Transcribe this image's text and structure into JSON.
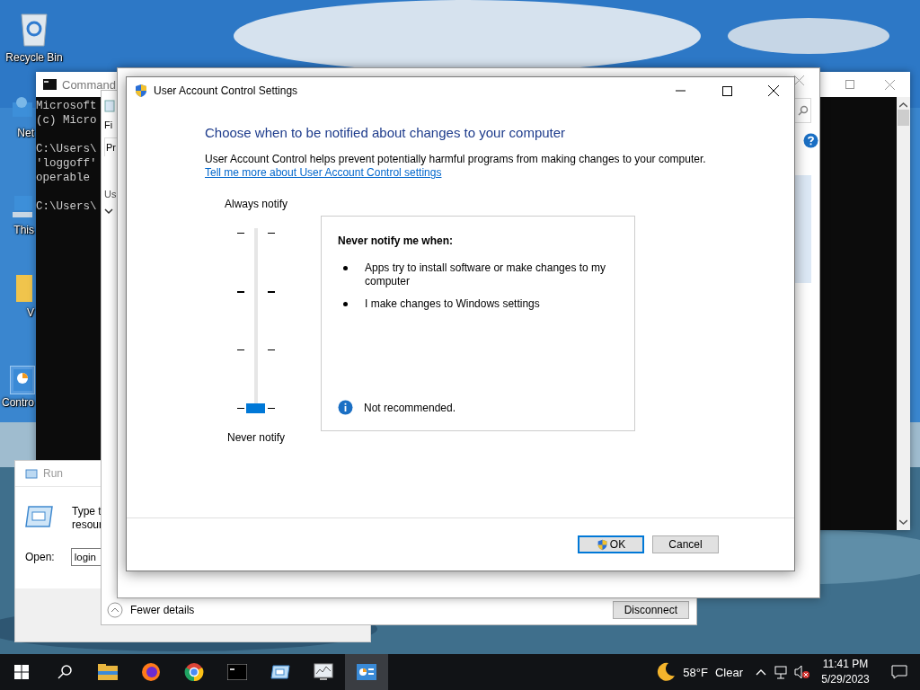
{
  "desktop": {
    "icons": [
      {
        "kind": "recycle",
        "label": "Recycle Bin",
        "selected": false
      },
      {
        "kind": "network",
        "label": "Net",
        "selected": false
      },
      {
        "kind": "pc",
        "label": "This",
        "selected": false
      },
      {
        "kind": "folder",
        "label": "V",
        "selected": false
      },
      {
        "kind": "control",
        "label": "Contro",
        "selected": true
      }
    ]
  },
  "command_prompt": {
    "title": "Command",
    "blocks": [
      [
        "Microsoft",
        "(c) Micro"
      ],
      [
        "C:\\Users\\",
        "'loggoff'",
        "operable"
      ],
      [
        "C:\\Users\\"
      ]
    ]
  },
  "run_dialog": {
    "title": "Run",
    "description_lines": [
      "Type t",
      "resour"
    ],
    "open_label": "Open:",
    "value": "login"
  },
  "task_manager": {
    "menu_stub": "Fi",
    "tab_stub": "Pr",
    "column_stub": "Us",
    "fewer_details": "Fewer details",
    "disconnect": "Disconnect"
  },
  "uac": {
    "title": "User Account Control Settings",
    "heading": "Choose when to be notified about changes to your computer",
    "description": "User Account Control helps prevent potentially harmful programs from making changes to your computer.",
    "link": "Tell me more about User Account Control settings",
    "top_label": "Always notify",
    "bottom_label": "Never notify",
    "slider": {
      "level": 0
    },
    "panel": {
      "heading": "Never notify me when:",
      "bullets": [
        "Apps try to install software or make changes to my computer",
        "I make changes to Windows settings"
      ],
      "note": "Not recommended."
    },
    "buttons": [
      {
        "label": "OK",
        "kind": "shield",
        "focused": true
      },
      {
        "label": "Cancel",
        "kind": "plain",
        "focused": false
      }
    ]
  },
  "taskbar": {
    "apps": [
      {
        "kind": "folder",
        "active": false
      },
      {
        "kind": "firefox",
        "active": false
      },
      {
        "kind": "chrome",
        "active": false
      },
      {
        "kind": "terminal",
        "active": false
      },
      {
        "kind": "run",
        "active": false
      },
      {
        "kind": "monitor",
        "active": false
      },
      {
        "kind": "control",
        "active": true
      }
    ],
    "weather": {
      "temperature": "58°F",
      "condition": "Clear"
    },
    "time": "11:41 PM",
    "date": "5/29/2023"
  }
}
